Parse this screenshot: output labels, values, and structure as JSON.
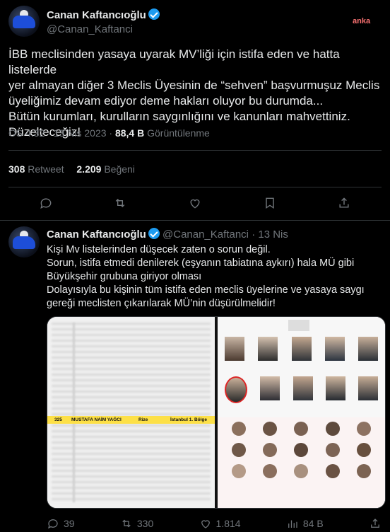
{
  "main_tweet": {
    "author_name": "Canan Kaftancıoğlu",
    "author_handle": "@Canan_Kaftanci",
    "badge": "anka",
    "text_lines": [
      "İBB meclisinden yasaya uyarak MV’liği için istifa eden ve hatta listelerde",
      "yer almayan diğer 3 Meclis Üyesinin de “sehven” başvurmuşuz Meclis",
      "üyeliğimiz devam ediyor deme hakları oluyor bu durumda...",
      "Bütün kurumları, kurulların saygınlığını ve kanunları mahvettiniz.",
      "Düzelteceğiz!"
    ],
    "time": "ÖS 4:32 · 13 Nis 2023 ·",
    "views_count": "88,4 B",
    "views_label": "Görüntülenme",
    "retweets_count": "308",
    "retweets_label": "Retweet",
    "likes_count": "2.209",
    "likes_label": "Beğeni"
  },
  "reply_tweet": {
    "author_name": "Canan Kaftancıoğlu",
    "author_handle": "@Canan_Kaftanci",
    "date": "· 13 Nis",
    "text_lines": [
      "Kişi Mv listelerinden düşecek zaten o sorun değil.",
      "Sorun, istifa etmedi denilerek (eşyanın tabiatına aykırı) hala MÜ gibi",
      "Büyükşehir grubuna giriyor olması",
      "Dolayısıyla bu kişinin tüm istifa eden meclis üyelerine ve yasaya saygı",
      "gereği meclisten çıkarılarak MÜ’nin düşürülmelidir!"
    ],
    "image": {
      "highlight_row": {
        "number": "325",
        "name": "MUSTAFA NAİM YAĞCI",
        "city": "Rize",
        "district": "İstanbul 1. Bölge"
      }
    },
    "stats": {
      "replies": "39",
      "retweets": "330",
      "likes": "1.814",
      "views": "84 B"
    }
  },
  "icons": {
    "reply": "reply-icon",
    "retweet": "retweet-icon",
    "like": "heart-icon",
    "bookmark": "bookmark-icon",
    "share": "share-icon",
    "views": "views-icon"
  },
  "colors": {
    "background": "#000000",
    "text": "#e7e9ea",
    "muted": "#71767b",
    "verified": "#1d9bf0",
    "divider": "#2f3336",
    "highlight": "#fde047"
  }
}
